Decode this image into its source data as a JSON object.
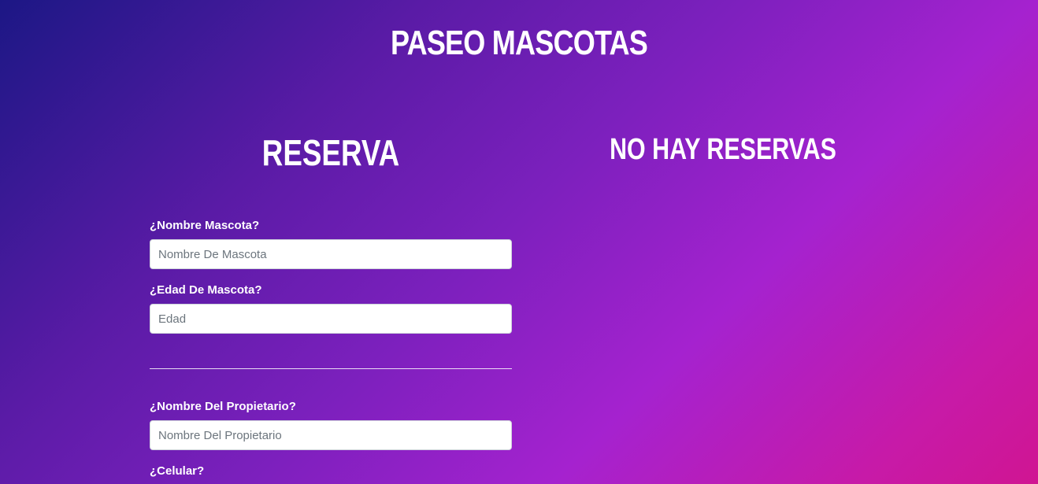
{
  "app": {
    "title": "PASEO MASCOTAS"
  },
  "form": {
    "title": "RESERVA",
    "pet_name": {
      "label": "¿Nombre Mascota?",
      "placeholder": "Nombre De Mascota",
      "value": ""
    },
    "pet_age": {
      "label": "¿Edad De Mascota?",
      "placeholder": "Edad",
      "value": ""
    },
    "owner_name": {
      "label": "¿Nombre Del Propietario?",
      "placeholder": "Nombre Del Propietario",
      "value": ""
    },
    "phone": {
      "label": "¿Celular?"
    }
  },
  "reservations": {
    "empty_title": "NO HAY RESERVAS"
  },
  "colors": {
    "gradient_start": "#1c1785",
    "gradient_mid": "#a522cf",
    "gradient_end": "#d01592",
    "text": "#ffffff"
  }
}
